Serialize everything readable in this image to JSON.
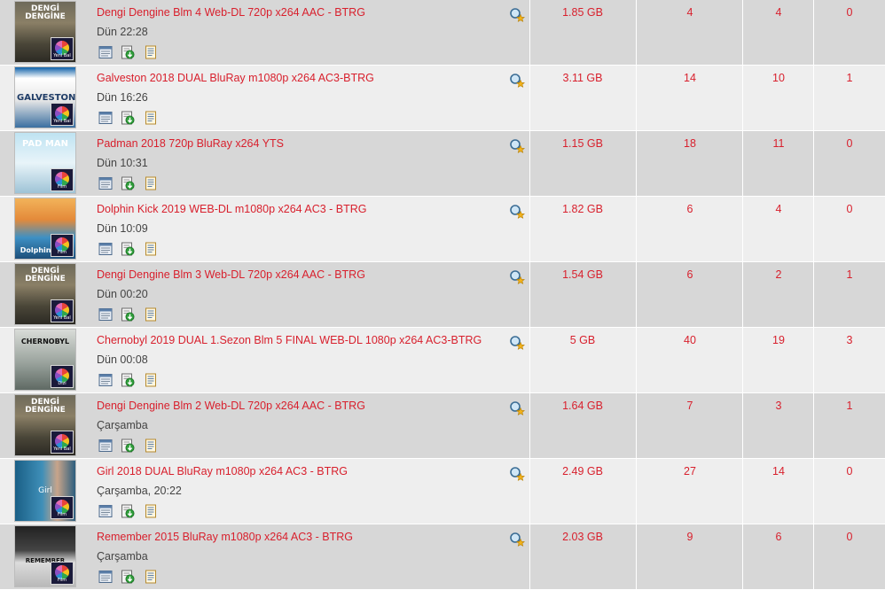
{
  "torrents": [
    {
      "title": "Dengi Dengine Blm 4 Web-DL 720p x264 AAC - BTRG",
      "date": "Dün 22:28",
      "size": "1.85 GB",
      "seeders": "4",
      "leechers": "4",
      "completed": "0",
      "poster": "dengi",
      "badge": "Yeni Bal"
    },
    {
      "title": "Galveston 2018 DUAL BluRay m1080p x264 AC3-BTRG",
      "date": "Dün 16:26",
      "size": "3.11 GB",
      "seeders": "14",
      "leechers": "10",
      "completed": "1",
      "poster": "galveston",
      "badge": "Yeni Bal"
    },
    {
      "title": "Padman 2018 720p BluRay x264 YTS",
      "date": "Dün 10:31",
      "size": "1.15 GB",
      "seeders": "18",
      "leechers": "11",
      "completed": "0",
      "poster": "padman",
      "badge": "Film"
    },
    {
      "title": "Dolphin Kick 2019 WEB-DL m1080p x264 AC3 - BTRG",
      "date": "Dün 10:09",
      "size": "1.82 GB",
      "seeders": "6",
      "leechers": "4",
      "completed": "0",
      "poster": "dolphin",
      "badge": "Film"
    },
    {
      "title": "Dengi Dengine Blm 3 Web-DL 720p x264 AAC - BTRG",
      "date": "Dün 00:20",
      "size": "1.54 GB",
      "seeders": "6",
      "leechers": "2",
      "completed": "1",
      "poster": "dengi",
      "badge": "Yeni Bal"
    },
    {
      "title": "Chernobyl 2019 DUAL 1.Sezon Blm 5 FINAL WEB-DL 1080p x264 AC3-BTRG",
      "date": "Dün 00:08",
      "size": "5 GB",
      "seeders": "40",
      "leechers": "19",
      "completed": "3",
      "poster": "chernobyl",
      "badge": "Dizi"
    },
    {
      "title": "Dengi Dengine Blm 2 Web-DL 720p x264 AAC - BTRG",
      "date": "Çarşamba",
      "size": "1.64 GB",
      "seeders": "7",
      "leechers": "3",
      "completed": "1",
      "poster": "dengi",
      "badge": "Yeni Bal"
    },
    {
      "title": "Girl 2018 DUAL BluRay m1080p x264 AC3 - BTRG",
      "date": "Çarşamba, 20:22",
      "size": "2.49 GB",
      "seeders": "27",
      "leechers": "14",
      "completed": "0",
      "poster": "girl",
      "badge": "Film"
    },
    {
      "title": "Remember 2015 BluRay m1080p x264 AC3 - BTRG",
      "date": "Çarşamba",
      "size": "2.03 GB",
      "seeders": "9",
      "leechers": "6",
      "completed": "0",
      "poster": "remember",
      "badge": "Film"
    }
  ],
  "poster_texts": {
    "dengi": "DENGİ DENGİNE",
    "galveston": "GALVESTON",
    "padman": "PAD MAN",
    "dolphin": "Dolphin Kick",
    "chernobyl": "CHERNOBYL",
    "girl": "Girl",
    "remember": "REMEMBER"
  },
  "icons": {
    "magnet": "magnifier-star-icon",
    "action_1": "nfo-window-icon",
    "action_2": "download-arrow-icon",
    "action_3": "details-page-icon"
  },
  "colors": {
    "title_red": "#d8202d",
    "row_odd": "#d7d7d7",
    "row_even": "#eeeeee"
  }
}
